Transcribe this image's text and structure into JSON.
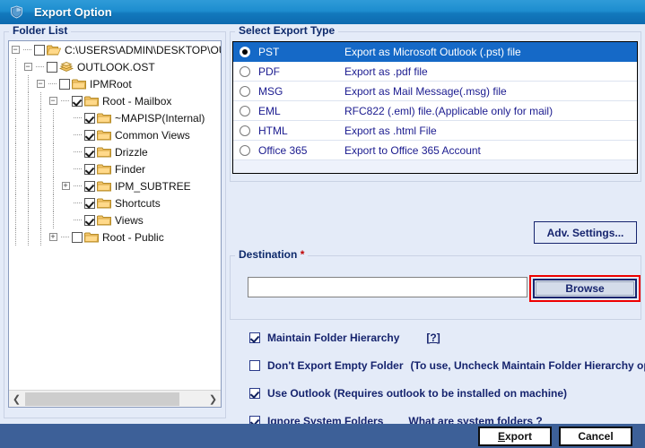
{
  "window": {
    "title": "Export Option",
    "icon": "shield-icon"
  },
  "folder_panel": {
    "legend": "Folder List",
    "tree": [
      {
        "label": "C:\\USERS\\ADMIN\\DESKTOP\\OUTL(",
        "depth": 0,
        "checked": false,
        "expander": "minus",
        "icon": "open-folder-icon"
      },
      {
        "label": "OUTLOOK.OST",
        "depth": 1,
        "checked": false,
        "expander": "minus",
        "icon": "ost-file-icon"
      },
      {
        "label": "IPMRoot",
        "depth": 2,
        "checked": false,
        "expander": "minus",
        "icon": "folder-icon"
      },
      {
        "label": "Root - Mailbox",
        "depth": 3,
        "checked": true,
        "expander": "minus",
        "icon": "folder-icon"
      },
      {
        "label": "~MAPISP(Internal)",
        "depth": 4,
        "checked": true,
        "expander": "none",
        "icon": "folder-icon"
      },
      {
        "label": "Common Views",
        "depth": 4,
        "checked": true,
        "expander": "none",
        "icon": "folder-icon"
      },
      {
        "label": "Drizzle",
        "depth": 4,
        "checked": true,
        "expander": "none",
        "icon": "folder-icon"
      },
      {
        "label": "Finder",
        "depth": 4,
        "checked": true,
        "expander": "none",
        "icon": "folder-icon"
      },
      {
        "label": "IPM_SUBTREE",
        "depth": 4,
        "checked": true,
        "expander": "plus",
        "icon": "folder-icon"
      },
      {
        "label": "Shortcuts",
        "depth": 4,
        "checked": true,
        "expander": "none",
        "icon": "folder-icon"
      },
      {
        "label": "Views",
        "depth": 4,
        "checked": true,
        "expander": "none",
        "icon": "folder-icon"
      },
      {
        "label": "Root - Public",
        "depth": 3,
        "checked": false,
        "expander": "plus",
        "icon": "folder-icon"
      }
    ],
    "scrollbar": {
      "left_arrow": "❮",
      "right_arrow": "❯"
    }
  },
  "export_type": {
    "legend": "Select Export Type",
    "selected": "PST",
    "options": [
      {
        "name": "PST",
        "description": "Export as Microsoft Outlook (.pst) file",
        "selected": true
      },
      {
        "name": "PDF",
        "description": "Export as .pdf file",
        "selected": false
      },
      {
        "name": "MSG",
        "description": "Export as Mail Message(.msg) file",
        "selected": false
      },
      {
        "name": "EML",
        "description": "RFC822 (.eml) file.(Applicable only for mail)",
        "selected": false
      },
      {
        "name": "HTML",
        "description": "Export as .html File",
        "selected": false
      },
      {
        "name": "Office 365",
        "description": "Export to Office 365 Account",
        "selected": false
      }
    ]
  },
  "adv_settings": {
    "label": "Adv. Settings..."
  },
  "destination": {
    "legend": "Destination",
    "required_marker": "*",
    "value": "",
    "placeholder": "",
    "browse_label": "Browse",
    "highlighted": true,
    "highlight_color": "#ee0000"
  },
  "options": [
    {
      "label": "Maintain Folder Hierarchy",
      "checked": true,
      "link": "[?]",
      "hint": ""
    },
    {
      "label": "Don't Export Empty Folder",
      "checked": false,
      "link": "",
      "hint": "(To use, Uncheck Maintain Folder Hierarchy option)"
    },
    {
      "label": "Use Outlook (Requires outlook to be installed on machine)",
      "checked": true,
      "link": "",
      "hint": ""
    },
    {
      "label": "Ignore System Folders",
      "checked": true,
      "link": "What are system folders ?",
      "hint": ""
    }
  ],
  "footer": {
    "export_label": "Export",
    "cancel_label": "Cancel"
  },
  "colors": {
    "titlebar_blue": "#1d8dcf",
    "selected_row": "#1569c7",
    "dialog_bg": "#e4ebf8",
    "footer_bg": "#3d6098",
    "text_navy": "#16246e",
    "highlight_red": "#ee0000"
  }
}
